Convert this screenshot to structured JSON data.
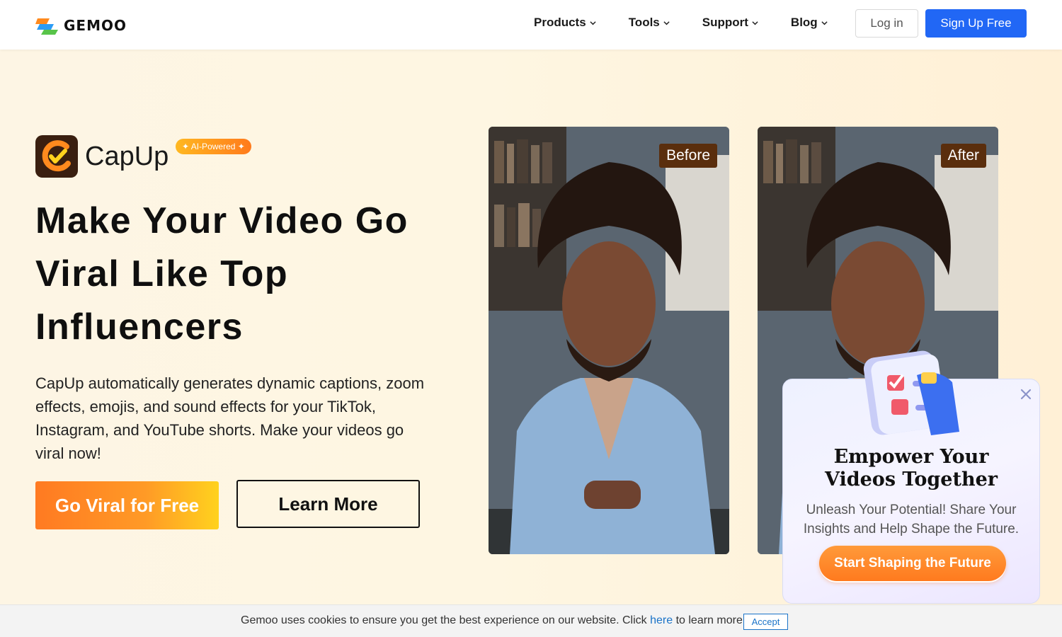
{
  "brand": {
    "name": "GEMOO"
  },
  "nav": {
    "items": [
      {
        "label": "Products"
      },
      {
        "label": "Tools"
      },
      {
        "label": "Support"
      },
      {
        "label": "Blog"
      }
    ],
    "login_label": "Log in",
    "signup_label": "Sign Up Free"
  },
  "hero": {
    "product_name": "CapUp",
    "badge": "✦ AI-Powered ✦",
    "headline_lines": [
      "Make Your Video Go",
      "Viral Like Top",
      "Influencers"
    ],
    "description": "CapUp automatically generates dynamic captions, zoom effects, emojis, and sound effects for your TikTok, Instagram, and YouTube shorts. Make your videos go viral now!",
    "primary_cta": "Go Viral for Free",
    "secondary_cta": "Learn More",
    "videos": [
      {
        "tag": "Before"
      },
      {
        "tag": "After"
      }
    ]
  },
  "popup": {
    "title_lines": [
      "Empower Your",
      "Videos Together"
    ],
    "subtitle": "Unleash Your Potential! Share Your Insights and Help Shape the Future.",
    "cta": "Start Shaping the Future"
  },
  "cookie": {
    "text_before": "Gemoo uses cookies to ensure you get the best experience on our website. Click ",
    "link": "here",
    "text_after": " to learn more.",
    "accept": "Accept"
  },
  "colors": {
    "accent_blue": "#2167f5",
    "cta_orange": "#ff7a22",
    "video_tag": "#5a2e0d"
  }
}
